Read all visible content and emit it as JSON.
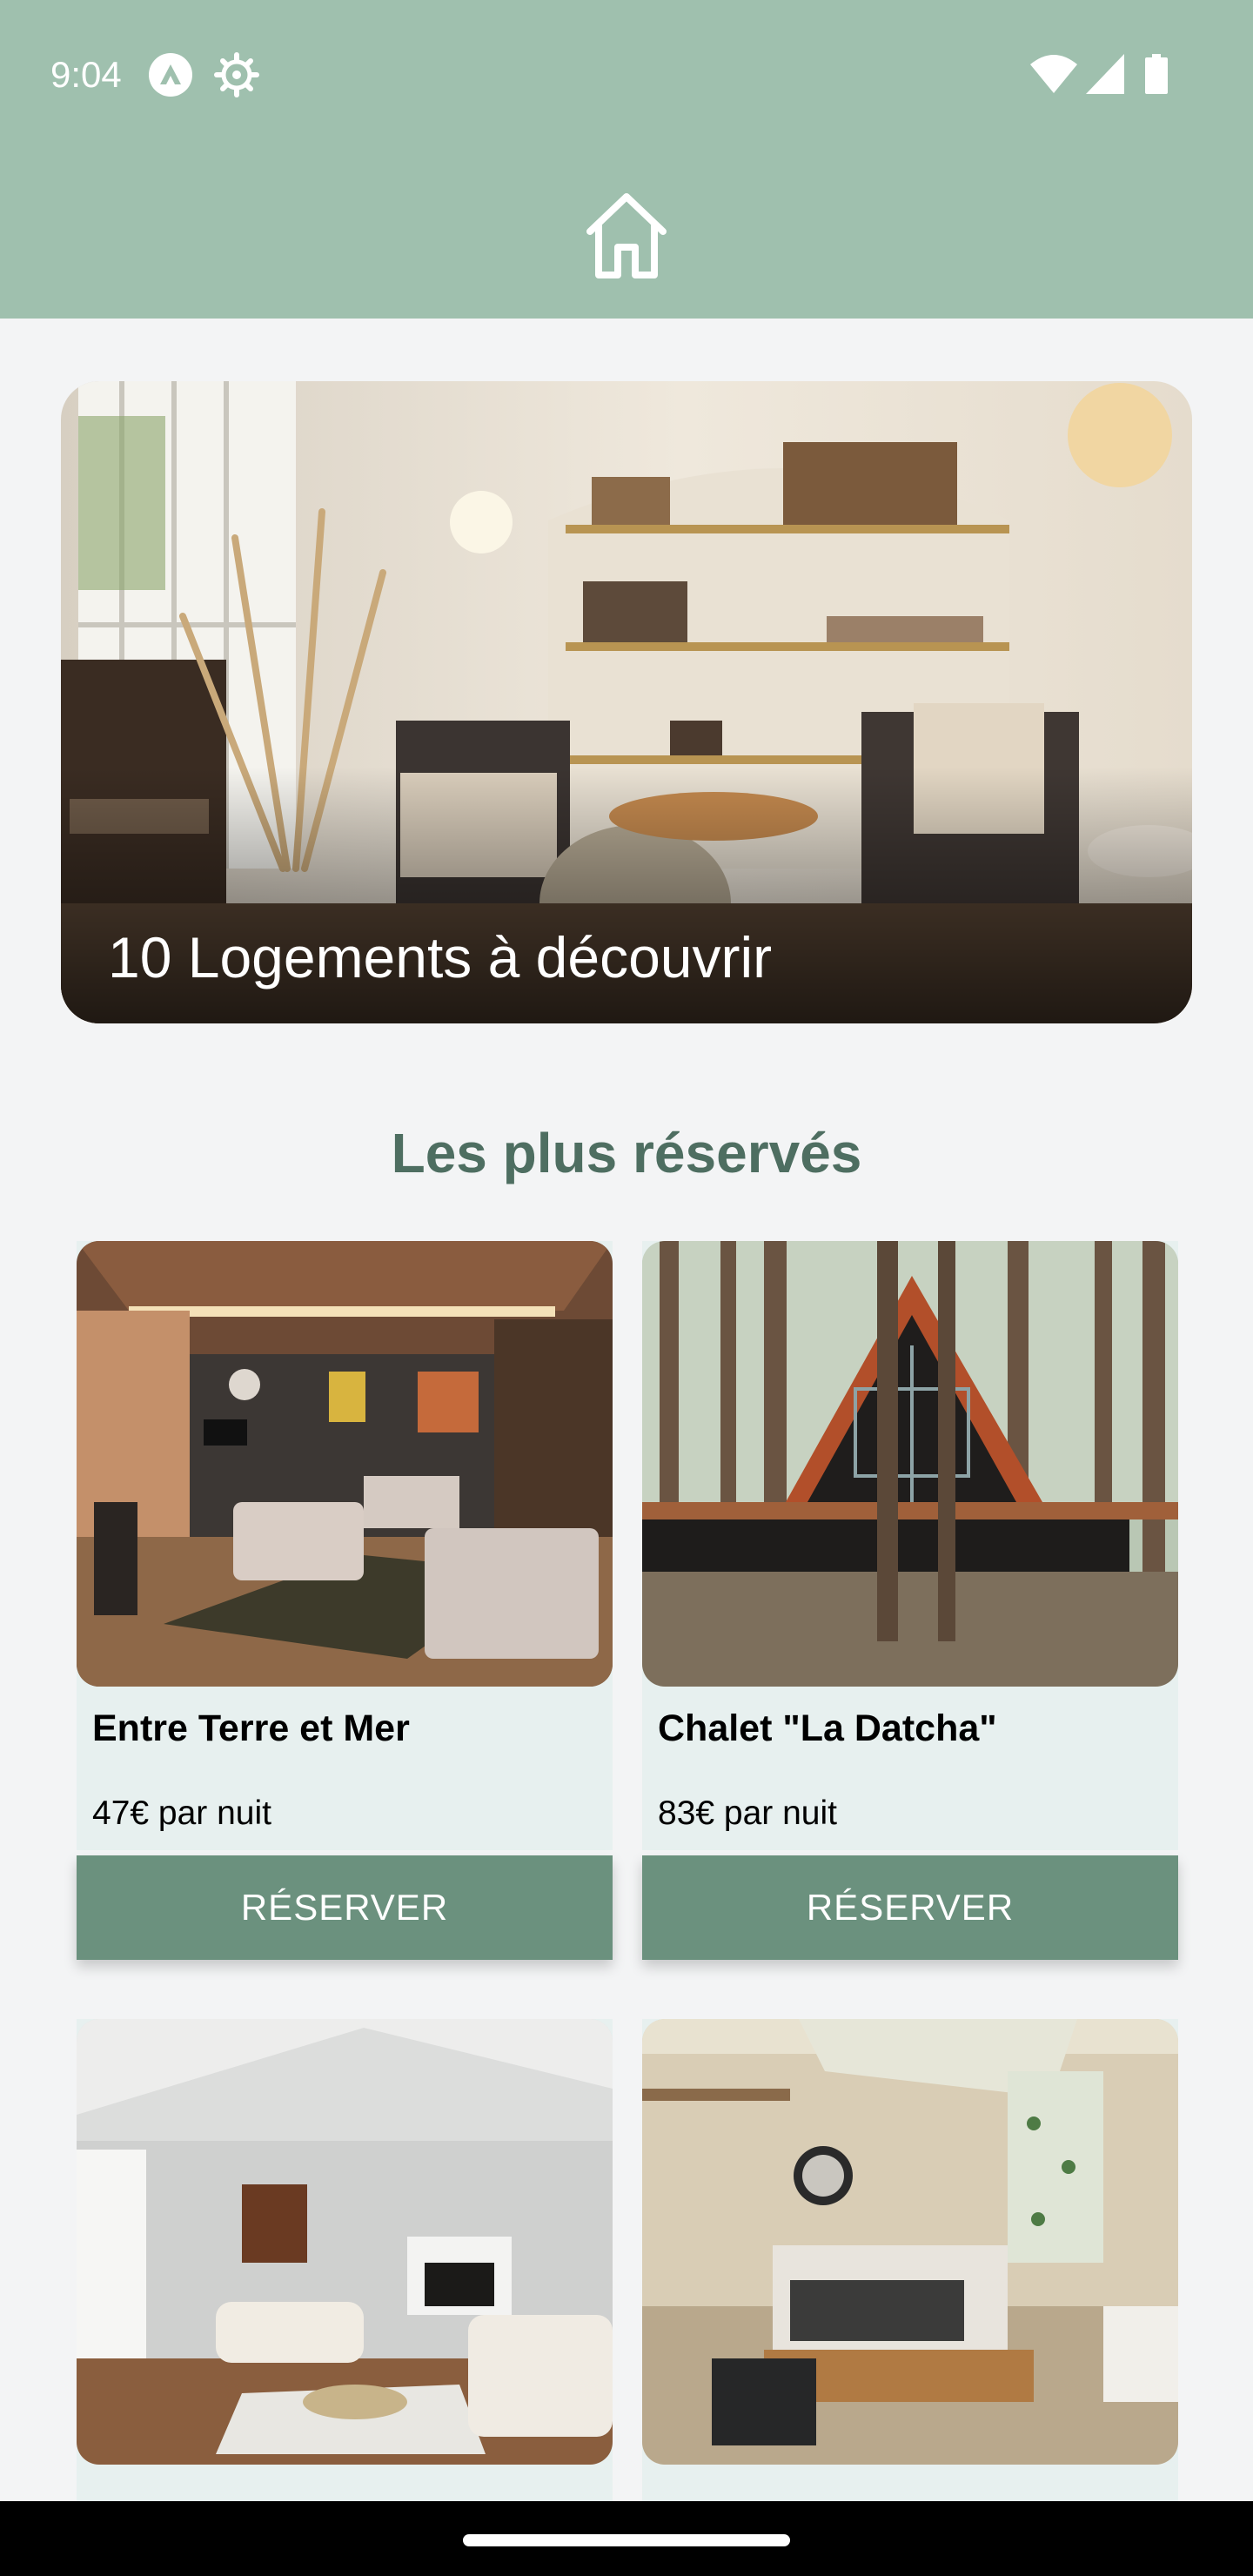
{
  "status_bar": {
    "time": "9:04",
    "icons": [
      "app-notification-icon",
      "settings-gear-icon",
      "wifi-icon",
      "signal-icon",
      "battery-icon"
    ]
  },
  "app_bar": {
    "icon": "home-icon"
  },
  "hero": {
    "title": "10 Logements à découvrir"
  },
  "section": {
    "title": "Les plus réservés"
  },
  "listings": [
    {
      "title": "Entre Terre et Mer",
      "price": "47€ par nuit",
      "button": "RÉSERVER"
    },
    {
      "title": "Chalet \"La Datcha\"",
      "price": "83€ par nuit",
      "button": "RÉSERVER"
    },
    {
      "title": "",
      "price": "",
      "button": ""
    },
    {
      "title": "",
      "price": "",
      "button": ""
    }
  ],
  "colors": {
    "app_bar": "#9fc0ae",
    "accent": "#6b917e",
    "section_title": "#4e6e61",
    "card_background": "#e7f0ef",
    "page_background": "#f3f4f5"
  }
}
